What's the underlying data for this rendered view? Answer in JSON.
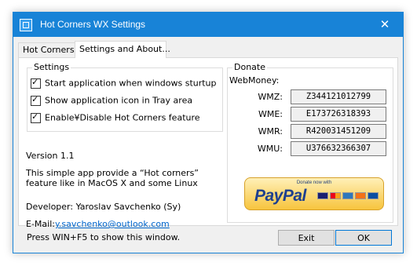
{
  "window": {
    "title": "Hot Corners WX Settings",
    "close_symbol": "✕"
  },
  "tabs": [
    {
      "label": "Hot Corners",
      "active": false
    },
    {
      "label": "Settings and About...",
      "active": true
    }
  ],
  "settings_group": {
    "title": "Settings",
    "options": [
      {
        "label": "Start application when windows sturtup",
        "checked": true
      },
      {
        "label": "Show application icon in Tray area",
        "checked": true
      },
      {
        "label": "Enable¥Disable Hot Corners feature",
        "checked": true
      }
    ]
  },
  "about": {
    "version": "Version 1.1",
    "description_line1": "This simple app provide a “Hot corners”",
    "description_line2": "feature like in MacOS X and some Linux",
    "developer": "Developer: Yaroslav Savchenko (Sy)",
    "email_label": "E-Mail:",
    "email": "y.savchenko@outlook.com"
  },
  "donate": {
    "title": "Donate",
    "webmoney_label": "WebMoney:",
    "wallets": [
      {
        "label": "WMZ:",
        "value": "Z344121012799"
      },
      {
        "label": "WME:",
        "value": "E173726318393"
      },
      {
        "label": "WMR:",
        "value": "R420031451209"
      },
      {
        "label": "WMU:",
        "value": "U376632366307"
      }
    ],
    "paypal": {
      "caption": "Donate now with",
      "logo": "PayPal"
    }
  },
  "footer": {
    "hint": "Press WIN+F5 to show this window.",
    "exit_label": "Exit",
    "ok_label": "OK"
  },
  "colors": {
    "titlebar": "#1883d7",
    "link": "#0066cc"
  }
}
